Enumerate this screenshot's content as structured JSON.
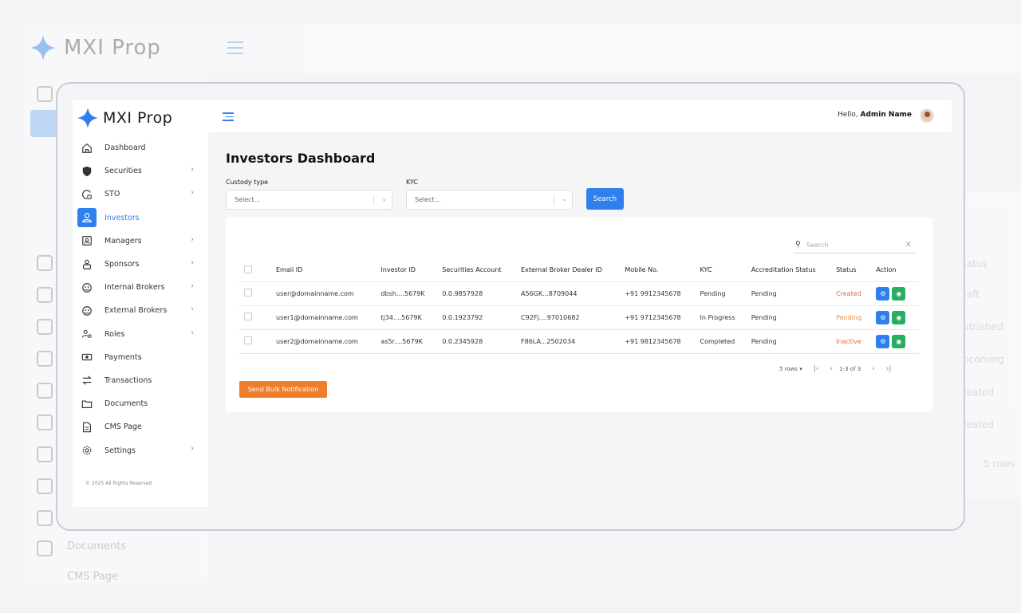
{
  "app": {
    "name": "MXI Prop"
  },
  "background": {
    "nav_labels": [
      "Documents",
      "CMS Page"
    ],
    "right_col": [
      "tatus",
      "raft",
      "ublished",
      "pcoming",
      "reated",
      "reated",
      "5 rows"
    ]
  },
  "sidebar": {
    "items": [
      {
        "label": "Dashboard",
        "icon": "home-icon",
        "chevron": false
      },
      {
        "label": "Securities",
        "icon": "shield-icon",
        "chevron": true
      },
      {
        "label": "STO",
        "icon": "sto-icon",
        "chevron": true
      },
      {
        "label": "Investors",
        "icon": "user-icon",
        "chevron": false,
        "active": true
      },
      {
        "label": "Managers",
        "icon": "id-badge-icon",
        "chevron": true
      },
      {
        "label": "Sponsors",
        "icon": "sponsor-icon",
        "chevron": true
      },
      {
        "label": "Internal Brokers",
        "icon": "broker-icon",
        "chevron": true
      },
      {
        "label": "External Brokers",
        "icon": "broker-icon",
        "chevron": true
      },
      {
        "label": "Roles",
        "icon": "users-icon",
        "chevron": true
      },
      {
        "label": "Payments",
        "icon": "cash-icon",
        "chevron": false
      },
      {
        "label": "Transactions",
        "icon": "transfer-icon",
        "chevron": false
      },
      {
        "label": "Documents",
        "icon": "folder-icon",
        "chevron": false
      },
      {
        "label": "CMS Page",
        "icon": "file-icon",
        "chevron": false
      },
      {
        "label": "Settings",
        "icon": "gear-icon",
        "chevron": true
      }
    ],
    "copyright": "© 2025 All Rights Reserved"
  },
  "header": {
    "hello": "Hello,",
    "user": "Admin Name"
  },
  "page": {
    "title": "Investors Dashboard"
  },
  "filters": {
    "custody_label": "Custody type",
    "custody_placeholder": "Select...",
    "kyc_label": "KYC",
    "kyc_placeholder": "Select...",
    "search_button": "Search"
  },
  "table": {
    "search_placeholder": "Search",
    "columns": [
      "Email ID",
      "Investor ID",
      "Securities Account",
      "External Broker Dealer ID",
      "Mobile No.",
      "KYC",
      "Accreditation Status",
      "Status",
      "Action"
    ],
    "rows": [
      {
        "email": "user@domainname.com",
        "investor_id": "dbsh....5679K",
        "securities": "0.0.9857928",
        "broker_id": "A56GK...8709044",
        "mobile": "+91 9912345678",
        "kyc": "Pending",
        "accreditation": "Pending",
        "status": "Created",
        "status_color": "#e66a3b"
      },
      {
        "email": "user1@domainname.com",
        "investor_id": "tj34....5679K",
        "securities": "0.0.1923792",
        "broker_id": "C92Fj....97010682",
        "mobile": "+91 9712345678",
        "kyc": "In Progress",
        "accreditation": "Pending",
        "status": "Pending",
        "status_color": "#e68f4a"
      },
      {
        "email": "user2@domainname.com",
        "investor_id": "as5r....5679K",
        "securities": "0.0.2345928",
        "broker_id": "F86LA...2502034",
        "mobile": "+91 9812345678",
        "kyc": "Completed",
        "accreditation": "Pending",
        "status": "Inactive",
        "status_color": "#e66a3b"
      }
    ]
  },
  "pagination": {
    "rows": "5 rows",
    "range": "1-3 of 3"
  },
  "bulk_button": "Send Bulk Notification",
  "colors": {
    "primary": "#2f80ed",
    "success": "#27ae60",
    "warning": "#f07d2a"
  }
}
